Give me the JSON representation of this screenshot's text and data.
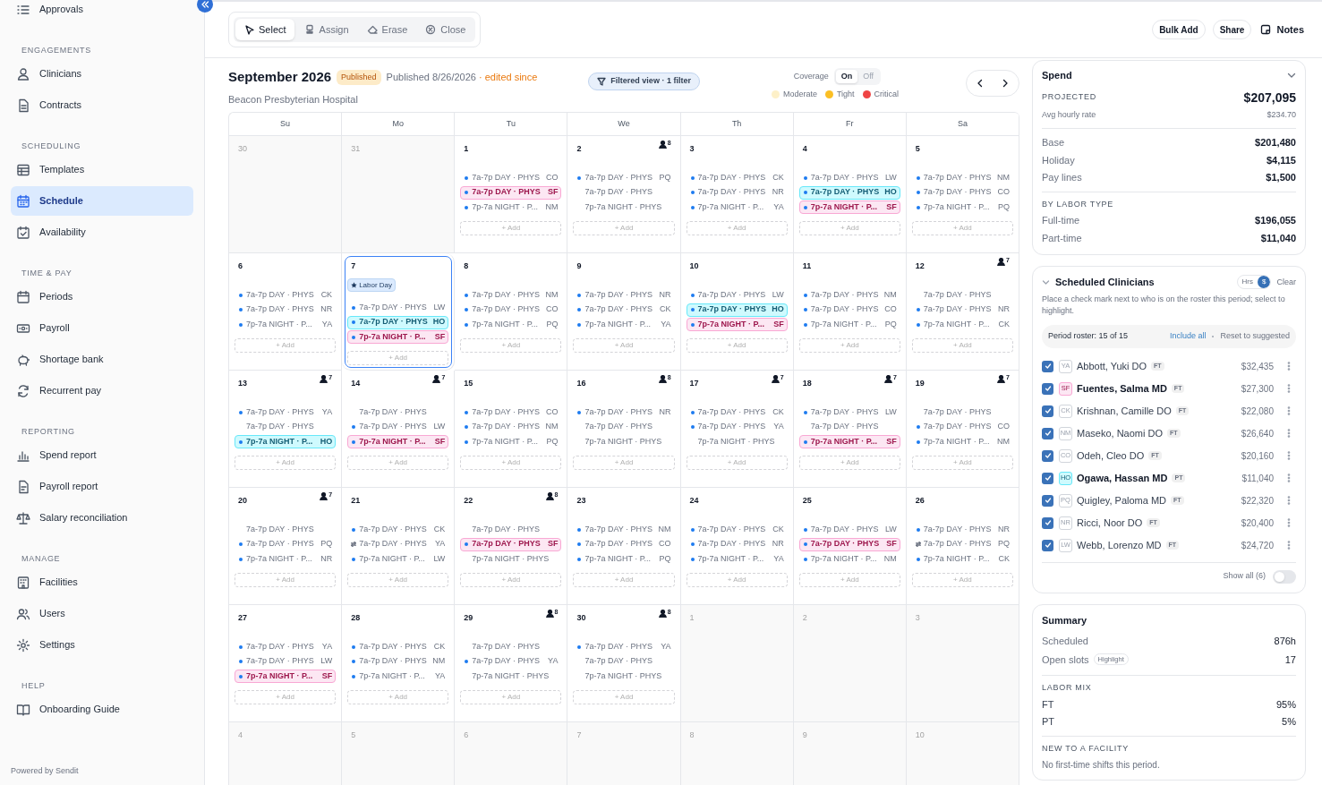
{
  "sidebar": {
    "sections": [
      {
        "items": [
          {
            "label": "Approvals",
            "selected": false
          }
        ]
      },
      {
        "title": "ENGAGEMENTS",
        "items": [
          {
            "label": "Clinicians",
            "selected": false
          },
          {
            "label": "Contracts",
            "selected": false
          }
        ]
      },
      {
        "title": "SCHEDULING",
        "items": [
          {
            "label": "Templates",
            "selected": false
          },
          {
            "label": "Schedule",
            "selected": true
          },
          {
            "label": "Availability",
            "selected": false
          }
        ]
      },
      {
        "title": "TIME & PAY",
        "items": [
          {
            "label": "Periods",
            "selected": false
          },
          {
            "label": "Payroll",
            "selected": false
          },
          {
            "label": "Shortage bank",
            "selected": false
          },
          {
            "label": "Recurrent pay",
            "selected": false
          }
        ]
      },
      {
        "title": "REPORTING",
        "items": [
          {
            "label": "Spend report",
            "selected": false
          },
          {
            "label": "Payroll report",
            "selected": false
          },
          {
            "label": "Salary reconciliation",
            "selected": false
          }
        ]
      },
      {
        "title": "MANAGE",
        "items": [
          {
            "label": "Facilities",
            "selected": false
          },
          {
            "label": "Users",
            "selected": false
          },
          {
            "label": "Settings",
            "selected": false
          }
        ]
      },
      {
        "title": "HELP",
        "items": [
          {
            "label": "Onboarding Guide",
            "selected": false
          }
        ]
      }
    ],
    "footer": "Powered by Sendit"
  },
  "toolbar": {
    "tools": [
      {
        "label": "Select",
        "selected": true
      },
      {
        "label": "Assign",
        "selected": false
      },
      {
        "label": "Erase",
        "selected": false
      },
      {
        "label": "Close",
        "selected": false
      }
    ],
    "actions": [
      "Bulk Add",
      "Share",
      "Notes"
    ]
  },
  "header": {
    "title": "September 2026",
    "badge": "Published",
    "published": "Published 8/26/2026",
    "edited": "· edited since",
    "facility": "Beacon Presbyterian Hospital",
    "filter": "Filtered view · 1 filter",
    "coverage": {
      "label": "Coverage",
      "options": [
        {
          "label": "On",
          "selected": true
        },
        {
          "label": "Off",
          "selected": false
        }
      ]
    },
    "legend": [
      {
        "label": "Moderate",
        "color": "#fdf0c8"
      },
      {
        "label": "Tight",
        "color": "#fbbf24"
      },
      {
        "label": "Critical",
        "color": "#ef4444"
      }
    ]
  },
  "calendar": {
    "weekdays": [
      "Su",
      "Mo",
      "Tu",
      "We",
      "Th",
      "Fr",
      "Sa"
    ],
    "weeks": [
      [
        {
          "day": "30",
          "outside": true,
          "selected": false
        },
        {
          "day": "31",
          "outside": true,
          "selected": false
        },
        {
          "day": "1",
          "outside": false,
          "selected": false,
          "shifts": [
            {
              "kind": "assigned",
              "label": "7a-7p DAY · PHYS",
              "who": "CO"
            },
            {
              "kind": "assigned",
              "label": "7a-7p DAY · PHYS",
              "who": "SF",
              "color": "#fce7f3"
            },
            {
              "kind": "assigned",
              "label": "7p-7a NIGHT · P...",
              "who": "NM"
            }
          ],
          "add": "+ Add"
        },
        {
          "day": "2",
          "outside": false,
          "selected": false,
          "count": "8",
          "shifts": [
            {
              "kind": "assigned",
              "label": "7a-7p DAY · PHYS",
              "who": "PQ"
            },
            {
              "kind": "open",
              "label": "7a-7p DAY · PHYS"
            },
            {
              "kind": "open",
              "label": "7p-7a NIGHT · PHYS"
            }
          ],
          "add": "+ Add"
        },
        {
          "day": "3",
          "outside": false,
          "selected": false,
          "shifts": [
            {
              "kind": "assigned",
              "label": "7a-7p DAY · PHYS",
              "who": "CK"
            },
            {
              "kind": "assigned",
              "label": "7a-7p DAY · PHYS",
              "who": "NR"
            },
            {
              "kind": "assigned",
              "label": "7p-7a NIGHT · P...",
              "who": "YA"
            }
          ],
          "add": "+ Add"
        },
        {
          "day": "4",
          "outside": false,
          "selected": false,
          "shifts": [
            {
              "kind": "assigned",
              "label": "7a-7p DAY · PHYS",
              "who": "LW"
            },
            {
              "kind": "assigned",
              "label": "7a-7p DAY · PHYS",
              "who": "HO",
              "color": "#cffafe"
            },
            {
              "kind": "assigned",
              "label": "7p-7a NIGHT · P...",
              "who": "SF",
              "color": "#fce7f3"
            }
          ],
          "add": "+ Add"
        },
        {
          "day": "5",
          "outside": false,
          "selected": false,
          "shifts": [
            {
              "kind": "assigned",
              "label": "7a-7p DAY · PHYS",
              "who": "NM"
            },
            {
              "kind": "assigned",
              "label": "7a-7p DAY · PHYS",
              "who": "CO"
            },
            {
              "kind": "assigned",
              "label": "7p-7a NIGHT · P...",
              "who": "PQ"
            }
          ],
          "add": "+ Add"
        }
      ],
      [
        {
          "day": "6",
          "outside": false,
          "selected": false,
          "shifts": [
            {
              "kind": "assigned",
              "label": "7a-7p DAY · PHYS",
              "who": "CK"
            },
            {
              "kind": "assigned",
              "label": "7a-7p DAY · PHYS",
              "who": "NR"
            },
            {
              "kind": "assigned",
              "label": "7p-7a NIGHT · P...",
              "who": "YA"
            }
          ],
          "add": "+ Add"
        },
        {
          "day": "7",
          "outside": false,
          "selected": true,
          "holiday": "Labor Day",
          "shifts": [
            {
              "kind": "assigned",
              "label": "7a-7p DAY · PHYS",
              "who": "LW"
            },
            {
              "kind": "assigned",
              "label": "7a-7p DAY · PHYS",
              "who": "HO",
              "color": "#cffafe"
            },
            {
              "kind": "assigned",
              "label": "7p-7a NIGHT · P...",
              "who": "SF",
              "color": "#fce7f3"
            }
          ],
          "add": "+ Add"
        },
        {
          "day": "8",
          "outside": false,
          "selected": false,
          "shifts": [
            {
              "kind": "assigned",
              "label": "7a-7p DAY · PHYS",
              "who": "NM"
            },
            {
              "kind": "assigned",
              "label": "7a-7p DAY · PHYS",
              "who": "CO"
            },
            {
              "kind": "assigned",
              "label": "7p-7a NIGHT · P...",
              "who": "PQ"
            }
          ],
          "add": "+ Add"
        },
        {
          "day": "9",
          "outside": false,
          "selected": false,
          "shifts": [
            {
              "kind": "assigned",
              "label": "7a-7p DAY · PHYS",
              "who": "NR"
            },
            {
              "kind": "assigned",
              "label": "7a-7p DAY · PHYS",
              "who": "CK"
            },
            {
              "kind": "assigned",
              "label": "7p-7a NIGHT · P...",
              "who": "YA"
            }
          ],
          "add": "+ Add"
        },
        {
          "day": "10",
          "outside": false,
          "selected": false,
          "shifts": [
            {
              "kind": "assigned",
              "label": "7a-7p DAY · PHYS",
              "who": "LW"
            },
            {
              "kind": "assigned",
              "label": "7a-7p DAY · PHYS",
              "who": "HO",
              "color": "#cffafe"
            },
            {
              "kind": "assigned",
              "label": "7p-7a NIGHT · P...",
              "who": "SF",
              "color": "#fce7f3"
            }
          ],
          "add": "+ Add"
        },
        {
          "day": "11",
          "outside": false,
          "selected": false,
          "shifts": [
            {
              "kind": "assigned",
              "label": "7a-7p DAY · PHYS",
              "who": "NM"
            },
            {
              "kind": "assigned",
              "label": "7a-7p DAY · PHYS",
              "who": "CO"
            },
            {
              "kind": "assigned",
              "label": "7p-7a NIGHT · P...",
              "who": "PQ"
            }
          ],
          "add": "+ Add"
        },
        {
          "day": "12",
          "outside": false,
          "selected": false,
          "count": "7",
          "shifts": [
            {
              "kind": "open",
              "label": "7a-7p DAY · PHYS"
            },
            {
              "kind": "assigned",
              "label": "7a-7p DAY · PHYS",
              "who": "NR"
            },
            {
              "kind": "assigned",
              "label": "7p-7a NIGHT · P...",
              "who": "CK"
            }
          ],
          "add": "+ Add"
        }
      ],
      [
        {
          "day": "13",
          "outside": false,
          "selected": false,
          "count": "7",
          "shifts": [
            {
              "kind": "assigned",
              "label": "7a-7p DAY · PHYS",
              "who": "YA"
            },
            {
              "kind": "open",
              "label": "7a-7p DAY · PHYS"
            },
            {
              "kind": "assigned",
              "label": "7p-7a NIGHT · P...",
              "who": "HO",
              "color": "#cffafe"
            }
          ],
          "add": "+ Add"
        },
        {
          "day": "14",
          "outside": false,
          "selected": false,
          "count": "7",
          "shifts": [
            {
              "kind": "open",
              "label": "7a-7p DAY · PHYS"
            },
            {
              "kind": "assigned",
              "label": "7a-7p DAY · PHYS",
              "who": "LW"
            },
            {
              "kind": "assigned",
              "label": "7p-7a NIGHT · P...",
              "who": "SF",
              "color": "#fce7f3"
            }
          ],
          "add": "+ Add"
        },
        {
          "day": "15",
          "outside": false,
          "selected": false,
          "shifts": [
            {
              "kind": "assigned",
              "label": "7a-7p DAY · PHYS",
              "who": "CO"
            },
            {
              "kind": "assigned",
              "label": "7a-7p DAY · PHYS",
              "who": "NM"
            },
            {
              "kind": "assigned",
              "label": "7p-7a NIGHT · P...",
              "who": "PQ"
            }
          ],
          "add": "+ Add"
        },
        {
          "day": "16",
          "outside": false,
          "selected": false,
          "count": "8",
          "shifts": [
            {
              "kind": "assigned",
              "label": "7a-7p DAY · PHYS",
              "who": "NR"
            },
            {
              "kind": "open",
              "label": "7a-7p DAY · PHYS"
            },
            {
              "kind": "open",
              "label": "7p-7a NIGHT · PHYS"
            }
          ],
          "add": "+ Add"
        },
        {
          "day": "17",
          "outside": false,
          "selected": false,
          "count": "7",
          "shifts": [
            {
              "kind": "assigned",
              "label": "7a-7p DAY · PHYS",
              "who": "CK"
            },
            {
              "kind": "assigned",
              "label": "7a-7p DAY · PHYS",
              "who": "YA"
            },
            {
              "kind": "open",
              "label": "7p-7a NIGHT · PHYS"
            }
          ],
          "add": "+ Add"
        },
        {
          "day": "18",
          "outside": false,
          "selected": false,
          "count": "7",
          "shifts": [
            {
              "kind": "assigned",
              "label": "7a-7p DAY · PHYS",
              "who": "LW"
            },
            {
              "kind": "open",
              "label": "7a-7p DAY · PHYS"
            },
            {
              "kind": "assigned",
              "label": "7p-7a NIGHT · P...",
              "who": "SF",
              "color": "#fce7f3"
            }
          ],
          "add": "+ Add"
        },
        {
          "day": "19",
          "outside": false,
          "selected": false,
          "count": "7",
          "shifts": [
            {
              "kind": "open",
              "label": "7a-7p DAY · PHYS"
            },
            {
              "kind": "assigned",
              "label": "7a-7p DAY · PHYS",
              "who": "CO"
            },
            {
              "kind": "assigned",
              "label": "7p-7a NIGHT · P...",
              "who": "NM"
            }
          ],
          "add": "+ Add"
        }
      ],
      [
        {
          "day": "20",
          "outside": false,
          "selected": false,
          "count": "7",
          "shifts": [
            {
              "kind": "open",
              "label": "7a-7p DAY · PHYS"
            },
            {
              "kind": "assigned",
              "label": "7a-7p DAY · PHYS",
              "who": "PQ"
            },
            {
              "kind": "assigned",
              "label": "7p-7a NIGHT · P...",
              "who": "NR"
            }
          ],
          "add": "+ Add"
        },
        {
          "day": "21",
          "outside": false,
          "selected": false,
          "shifts": [
            {
              "kind": "assigned",
              "label": "7a-7p DAY · PHYS",
              "who": "CK"
            },
            {
              "kind": "swap",
              "label": "7a-7p DAY · PHYS",
              "who": "YA"
            },
            {
              "kind": "assigned",
              "label": "7p-7a NIGHT · P...",
              "who": "LW"
            }
          ],
          "add": "+ Add"
        },
        {
          "day": "22",
          "outside": false,
          "selected": false,
          "count": "8",
          "shifts": [
            {
              "kind": "open",
              "label": "7a-7p DAY · PHYS"
            },
            {
              "kind": "assigned",
              "label": "7a-7p DAY · PHYS",
              "who": "SF",
              "color": "#fce7f3"
            },
            {
              "kind": "open",
              "label": "7p-7a NIGHT · PHYS"
            }
          ],
          "add": "+ Add"
        },
        {
          "day": "23",
          "outside": false,
          "selected": false,
          "shifts": [
            {
              "kind": "assigned",
              "label": "7a-7p DAY · PHYS",
              "who": "NM"
            },
            {
              "kind": "assigned",
              "label": "7a-7p DAY · PHYS",
              "who": "CO"
            },
            {
              "kind": "assigned",
              "label": "7p-7a NIGHT · P...",
              "who": "PQ"
            }
          ],
          "add": "+ Add"
        },
        {
          "day": "24",
          "outside": false,
          "selected": false,
          "shifts": [
            {
              "kind": "assigned",
              "label": "7a-7p DAY · PHYS",
              "who": "CK"
            },
            {
              "kind": "assigned",
              "label": "7a-7p DAY · PHYS",
              "who": "NR"
            },
            {
              "kind": "assigned",
              "label": "7p-7a NIGHT · P...",
              "who": "YA"
            }
          ],
          "add": "+ Add"
        },
        {
          "day": "25",
          "outside": false,
          "selected": false,
          "shifts": [
            {
              "kind": "assigned",
              "label": "7a-7p DAY · PHYS",
              "who": "LW"
            },
            {
              "kind": "assigned",
              "label": "7a-7p DAY · PHYS",
              "who": "SF",
              "color": "#fce7f3"
            },
            {
              "kind": "assigned",
              "label": "7p-7a NIGHT · P...",
              "who": "NM"
            }
          ],
          "add": "+ Add"
        },
        {
          "day": "26",
          "outside": false,
          "selected": false,
          "shifts": [
            {
              "kind": "assigned",
              "label": "7a-7p DAY · PHYS",
              "who": "NR"
            },
            {
              "kind": "swap",
              "label": "7a-7p DAY · PHYS",
              "who": "PQ"
            },
            {
              "kind": "assigned",
              "label": "7p-7a NIGHT · P...",
              "who": "CK"
            }
          ],
          "add": "+ Add"
        }
      ],
      [
        {
          "day": "27",
          "outside": false,
          "selected": false,
          "shifts": [
            {
              "kind": "assigned",
              "label": "7a-7p DAY · PHYS",
              "who": "YA"
            },
            {
              "kind": "assigned",
              "label": "7a-7p DAY · PHYS",
              "who": "LW"
            },
            {
              "kind": "assigned",
              "label": "7p-7a NIGHT · P...",
              "who": "SF",
              "color": "#fce7f3"
            }
          ],
          "add": "+ Add"
        },
        {
          "day": "28",
          "outside": false,
          "selected": false,
          "shifts": [
            {
              "kind": "assigned",
              "label": "7a-7p DAY · PHYS",
              "who": "CK"
            },
            {
              "kind": "assigned",
              "label": "7a-7p DAY · PHYS",
              "who": "NM"
            },
            {
              "kind": "assigned",
              "label": "7p-7a NIGHT · P...",
              "who": "YA"
            }
          ],
          "add": "+ Add"
        },
        {
          "day": "29",
          "outside": false,
          "selected": false,
          "count": "8",
          "shifts": [
            {
              "kind": "open",
              "label": "7a-7p DAY · PHYS"
            },
            {
              "kind": "assigned",
              "label": "7a-7p DAY · PHYS",
              "who": "YA"
            },
            {
              "kind": "open",
              "label": "7p-7a NIGHT · PHYS"
            }
          ],
          "add": "+ Add"
        },
        {
          "day": "30",
          "outside": false,
          "selected": false,
          "count": "8",
          "shifts": [
            {
              "kind": "assigned",
              "label": "7a-7p DAY · PHYS",
              "who": "YA"
            },
            {
              "kind": "open",
              "label": "7a-7p DAY · PHYS"
            },
            {
              "kind": "open",
              "label": "7p-7a NIGHT · PHYS"
            }
          ],
          "add": "+ Add"
        },
        {
          "day": "1",
          "outside": true,
          "selected": false
        },
        {
          "day": "2",
          "outside": true,
          "selected": false
        },
        {
          "day": "3",
          "outside": true,
          "selected": false
        }
      ],
      [
        {
          "day": "4",
          "outside": true,
          "selected": false
        },
        {
          "day": "5",
          "outside": true,
          "selected": false
        },
        {
          "day": "6",
          "outside": true,
          "selected": false
        },
        {
          "day": "7",
          "outside": true,
          "selected": false
        },
        {
          "day": "8",
          "outside": true,
          "selected": false
        },
        {
          "day": "9",
          "outside": true,
          "selected": false
        },
        {
          "day": "10",
          "outside": true,
          "selected": false
        }
      ]
    ]
  },
  "spend": {
    "title": "Spend",
    "projected_label": "PROJECTED",
    "projected": "$207,095",
    "avg_label": "Avg hourly rate",
    "avg": "$234.70",
    "lines": [
      {
        "label": "Base",
        "value": "$201,480"
      },
      {
        "label": "Holiday",
        "value": "$4,115"
      },
      {
        "label": "Pay lines",
        "value": "$1,500"
      }
    ],
    "labor_title": "BY LABOR TYPE",
    "labor": [
      {
        "label": "Full-time",
        "value": "$196,055"
      },
      {
        "label": "Part-time",
        "value": "$11,040"
      }
    ]
  },
  "clinicians": {
    "title": "Scheduled Clinicians",
    "units": [
      {
        "label": "Hrs",
        "selected": false
      },
      {
        "label": "$",
        "selected": true
      }
    ],
    "clear": "Clear",
    "hint": "Place a check mark next to who is on the roster this period; select to highlight.",
    "roster": "Period roster: 15 of 15",
    "include": "Include all",
    "reset": "Reset to suggested",
    "list": [
      {
        "initials": "YA",
        "name": "Abbott, Yuki DO",
        "type": "FT",
        "amount": "$32,435",
        "checked": true,
        "highlighted": false
      },
      {
        "initials": "SF",
        "name": "Fuentes, Salma MD",
        "type": "FT",
        "amount": "$27,300",
        "checked": true,
        "highlighted": true,
        "color": "#fce7f3"
      },
      {
        "initials": "CK",
        "name": "Krishnan, Camille DO",
        "type": "FT",
        "amount": "$22,080",
        "checked": true,
        "highlighted": false
      },
      {
        "initials": "NM",
        "name": "Maseko, Naomi DO",
        "type": "FT",
        "amount": "$26,640",
        "checked": true,
        "highlighted": false
      },
      {
        "initials": "CO",
        "name": "Odeh, Cleo DO",
        "type": "FT",
        "amount": "$20,160",
        "checked": true,
        "highlighted": false
      },
      {
        "initials": "HO",
        "name": "Ogawa, Hassan MD",
        "type": "PT",
        "amount": "$11,040",
        "checked": true,
        "highlighted": true,
        "color": "#cffafe"
      },
      {
        "initials": "PQ",
        "name": "Quigley, Paloma MD",
        "type": "FT",
        "amount": "$22,320",
        "checked": true,
        "highlighted": false
      },
      {
        "initials": "NR",
        "name": "Ricci, Noor DO",
        "type": "FT",
        "amount": "$20,400",
        "checked": true,
        "highlighted": false
      },
      {
        "initials": "LW",
        "name": "Webb, Lorenzo MD",
        "type": "FT",
        "amount": "$24,720",
        "checked": true,
        "highlighted": false
      }
    ],
    "show_all": {
      "label": "Show all (6)",
      "on": false
    }
  },
  "summary": {
    "title": "Summary",
    "rows": [
      {
        "label": "Scheduled",
        "value": "876h"
      },
      {
        "label": "Open slots",
        "chip": "Highlight",
        "value": "17"
      }
    ],
    "mix_title": "LABOR MIX",
    "mix": [
      {
        "label": "FT",
        "value": "95%"
      },
      {
        "label": "PT",
        "value": "5%"
      }
    ],
    "new_title": "NEW TO A FACILITY",
    "new_text": "No first-time shifts this period."
  }
}
